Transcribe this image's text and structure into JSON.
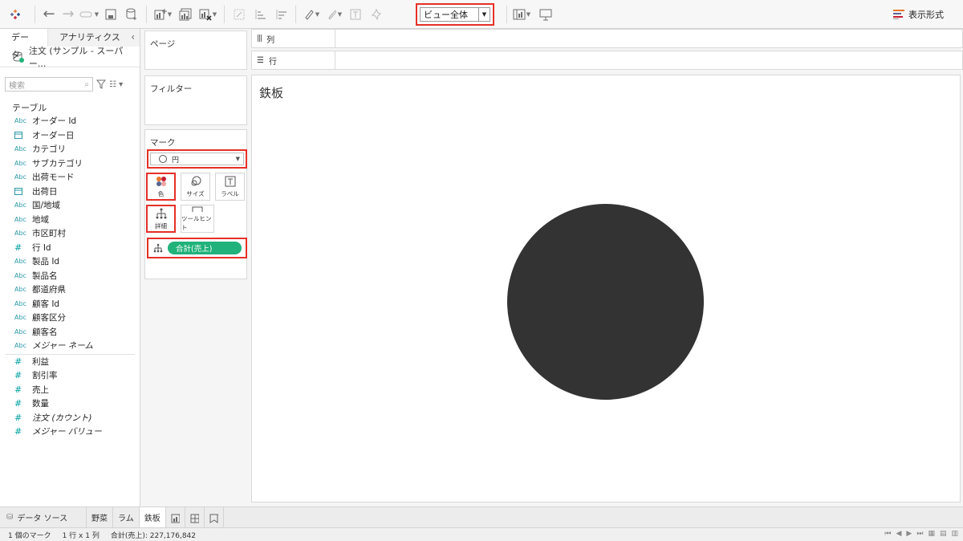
{
  "toolbar": {
    "view_select_value": "ビュー全体",
    "show_me_label": "表示形式"
  },
  "data_pane": {
    "tab_data": "データ",
    "tab_analytics": "アナリティクス",
    "datasource_name": "注文 (サンプル - スーパー...",
    "search_placeholder": "検索",
    "table_header": "テーブル",
    "dimensions": [
      {
        "type": "abc",
        "label": "オーダー Id"
      },
      {
        "type": "date",
        "label": "オーダー日"
      },
      {
        "type": "abc",
        "label": "カテゴリ"
      },
      {
        "type": "abc",
        "label": "サブカテゴリ"
      },
      {
        "type": "abc",
        "label": "出荷モード"
      },
      {
        "type": "date",
        "label": "出荷日"
      },
      {
        "type": "abc",
        "label": "国/地域"
      },
      {
        "type": "abc",
        "label": "地域"
      },
      {
        "type": "abc",
        "label": "市区町村"
      },
      {
        "type": "num",
        "label": "行 Id"
      },
      {
        "type": "abc",
        "label": "製品 Id"
      },
      {
        "type": "abc",
        "label": "製品名"
      },
      {
        "type": "abc",
        "label": "都道府県"
      },
      {
        "type": "abc",
        "label": "顧客 Id"
      },
      {
        "type": "abc",
        "label": "顧客区分"
      },
      {
        "type": "abc",
        "label": "顧客名"
      },
      {
        "type": "abc",
        "label": "メジャー ネーム",
        "italic": true
      }
    ],
    "measures": [
      {
        "label": "利益"
      },
      {
        "label": "割引率"
      },
      {
        "label": "売上"
      },
      {
        "label": "数量"
      },
      {
        "label": "注文 (カウント)",
        "italic": true
      },
      {
        "label": "メジャー バリュー",
        "italic": true
      }
    ]
  },
  "shelves": {
    "pages": "ページ",
    "filters": "フィルター",
    "marks": "マーク",
    "mark_type": "円",
    "btn_color": "色",
    "btn_size": "サイズ",
    "btn_label": "ラベル",
    "btn_detail": "詳細",
    "btn_tooltip": "ツールヒント",
    "pill": "合計(売上)"
  },
  "columns_label": "列",
  "rows_label": "行",
  "view": {
    "title": "鉄板",
    "mark_color": "#333333"
  },
  "sheet_tabs": {
    "datasource": "データ ソース",
    "sheets": [
      "野菜",
      "ラム",
      "鉄板"
    ],
    "active": "鉄板"
  },
  "status": {
    "marks": "1 個のマーク",
    "rowscols": "1 行 x 1 列",
    "sum": "合計(売上): 227,176,842"
  },
  "colors": {
    "highlight": "#e53027",
    "pill_green": "#20b27a",
    "field_teal": "#2b9aa8"
  }
}
